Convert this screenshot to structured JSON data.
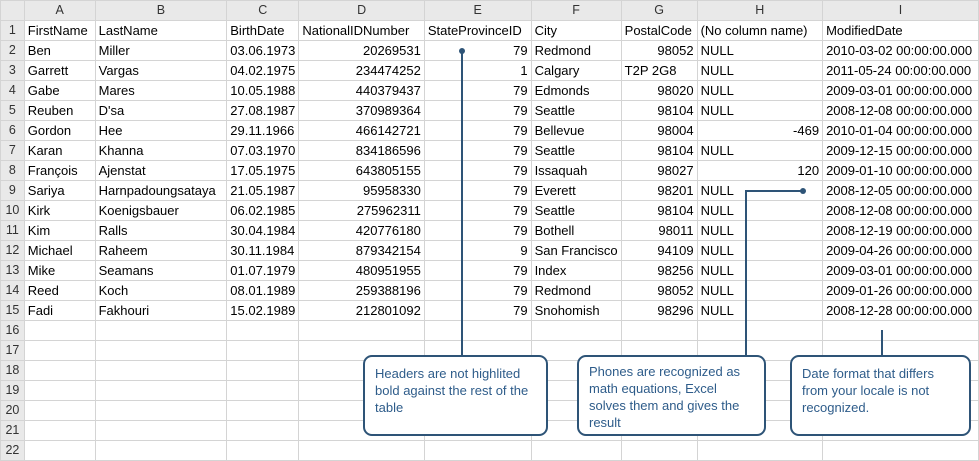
{
  "columns": [
    "A",
    "B",
    "C",
    "D",
    "E",
    "F",
    "G",
    "H",
    "I"
  ],
  "header_row": [
    "FirstName",
    "LastName",
    "BirthDate",
    "NationalIDNumber",
    "StateProvinceID",
    "City",
    "PostalCode",
    "(No column name)",
    "ModifiedDate"
  ],
  "rows": [
    [
      "Ben",
      "Miller",
      "03.06.1973",
      "20269531",
      "79",
      "Redmond",
      "98052",
      "NULL",
      "2010-03-02 00:00:00.000"
    ],
    [
      "Garrett",
      "Vargas",
      "04.02.1975",
      "234474252",
      "1",
      "Calgary",
      "T2P 2G8",
      "NULL",
      "2011-05-24 00:00:00.000"
    ],
    [
      "Gabe",
      "Mares",
      "10.05.1988",
      "440379437",
      "79",
      "Edmonds",
      "98020",
      "NULL",
      "2009-03-01 00:00:00.000"
    ],
    [
      "Reuben",
      "D'sa",
      "27.08.1987",
      "370989364",
      "79",
      "Seattle",
      "98104",
      "NULL",
      "2008-12-08 00:00:00.000"
    ],
    [
      "Gordon",
      "Hee",
      "29.11.1966",
      "466142721",
      "79",
      "Bellevue",
      "98004",
      "-469",
      "2010-01-04 00:00:00.000"
    ],
    [
      "Karan",
      "Khanna",
      "07.03.1970",
      "834186596",
      "79",
      "Seattle",
      "98104",
      "NULL",
      "2009-12-15 00:00:00.000"
    ],
    [
      "François",
      "Ajenstat",
      "17.05.1975",
      "643805155",
      "79",
      "Issaquah",
      "98027",
      "120",
      "2009-01-10 00:00:00.000"
    ],
    [
      "Sariya",
      "Harnpadoungsataya",
      "21.05.1987",
      "95958330",
      "79",
      "Everett",
      "98201",
      "NULL",
      "2008-12-05 00:00:00.000"
    ],
    [
      "Kirk",
      "Koenigsbauer",
      "06.02.1985",
      "275962311",
      "79",
      "Seattle",
      "98104",
      "NULL",
      "2008-12-08 00:00:00.000"
    ],
    [
      "Kim",
      "Ralls",
      "30.04.1984",
      "420776180",
      "79",
      "Bothell",
      "98011",
      "NULL",
      "2008-12-19 00:00:00.000"
    ],
    [
      "Michael",
      "Raheem",
      "30.11.1984",
      "879342154",
      "9",
      "San Francisco",
      "94109",
      "NULL",
      "2009-04-26 00:00:00.000"
    ],
    [
      "Mike",
      "Seamans",
      "01.07.1979",
      "480951955",
      "79",
      "Index",
      "98256",
      "NULL",
      "2009-03-01 00:00:00.000"
    ],
    [
      "Reed",
      "Koch",
      "08.01.1989",
      "259388196",
      "79",
      "Redmond",
      "98052",
      "NULL",
      "2009-01-26 00:00:00.000"
    ],
    [
      "Fadi",
      "Fakhouri",
      "15.02.1989",
      "212801092",
      "79",
      "Snohomish",
      "98296",
      "NULL",
      "2008-12-28 00:00:00.000"
    ]
  ],
  "row_numbers": [
    "1",
    "2",
    "3",
    "4",
    "5",
    "6",
    "7",
    "8",
    "9",
    "10",
    "11",
    "12",
    "13",
    "14",
    "15",
    "16",
    "17",
    "18",
    "19",
    "20",
    "21",
    "22"
  ],
  "callouts": {
    "headers": "Headers are not highlited bold against the rest of the table",
    "phones": "Phones are recognized as math equations, Excel solves them and gives the result",
    "dates": "Date format that differs from your locale is not recognized."
  },
  "colors": {
    "callout_border": "#2e5477",
    "callout_text": "#2e5c8a",
    "grid_line": "#d4d4d4",
    "header_bg": "#e9e9e9"
  }
}
